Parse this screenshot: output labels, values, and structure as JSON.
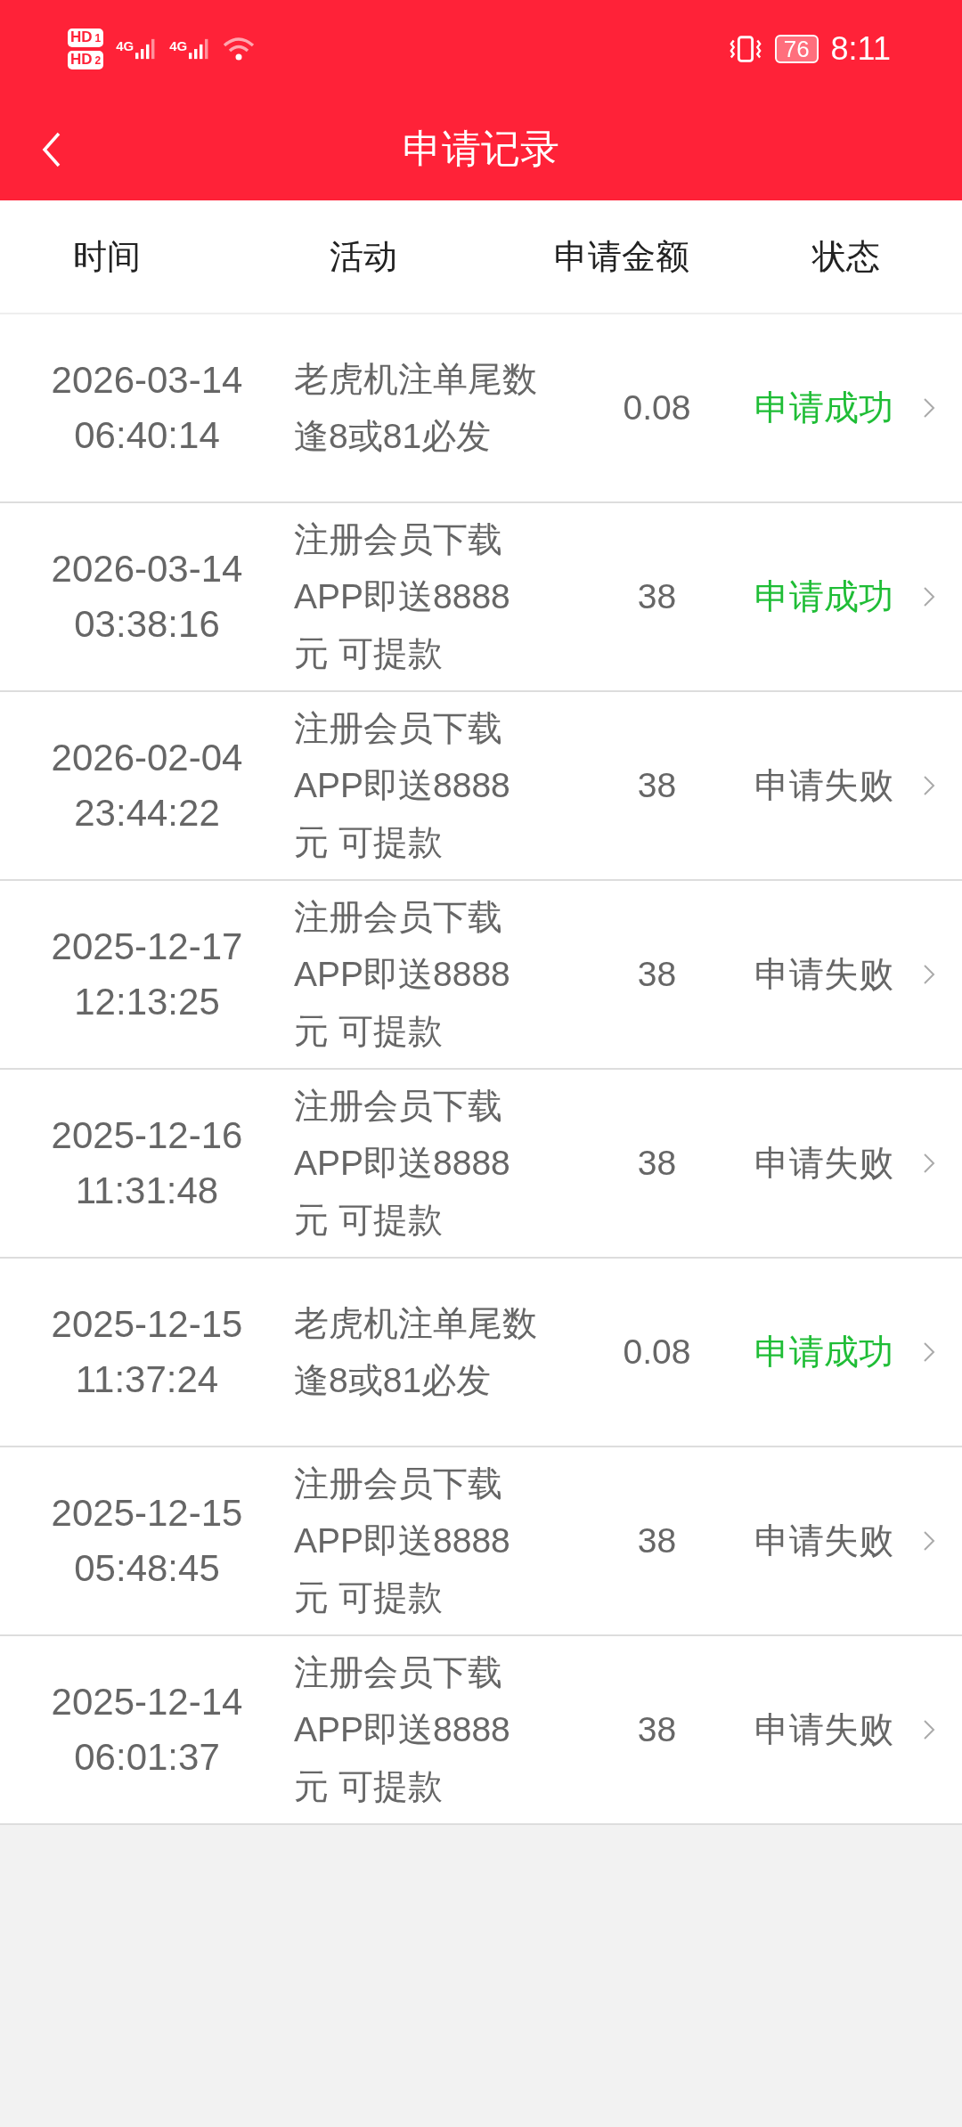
{
  "status_bar": {
    "sims": [
      {
        "label": "HD",
        "index": "1"
      },
      {
        "label": "HD",
        "index": "2"
      }
    ],
    "networks": [
      "4G",
      "4G"
    ],
    "battery": "76",
    "time": "8:11"
  },
  "header": {
    "title": "申请记录"
  },
  "columns": [
    "时间",
    "活动",
    "申请金额",
    "状态"
  ],
  "rows": [
    {
      "date": "2026-03-14",
      "time": "06:40:14",
      "activity": "老虎机注单尾数逢8或81必发",
      "amount": "0.08",
      "status": "申请成功",
      "success": true
    },
    {
      "date": "2026-03-14",
      "time": "03:38:16",
      "activity": "注册会员下载APP即送8888元 可提款",
      "amount": "38",
      "status": "申请成功",
      "success": true
    },
    {
      "date": "2026-02-04",
      "time": "23:44:22",
      "activity": "注册会员下载APP即送8888元 可提款",
      "amount": "38",
      "status": "申请失败",
      "success": false
    },
    {
      "date": "2025-12-17",
      "time": "12:13:25",
      "activity": "注册会员下载APP即送8888元 可提款",
      "amount": "38",
      "status": "申请失败",
      "success": false
    },
    {
      "date": "2025-12-16",
      "time": "11:31:48",
      "activity": "注册会员下载APP即送8888元 可提款",
      "amount": "38",
      "status": "申请失败",
      "success": false
    },
    {
      "date": "2025-12-15",
      "time": "11:37:24",
      "activity": "老虎机注单尾数逢8或81必发",
      "amount": "0.08",
      "status": "申请成功",
      "success": true
    },
    {
      "date": "2025-12-15",
      "time": "05:48:45",
      "activity": "注册会员下载APP即送8888元 可提款",
      "amount": "38",
      "status": "申请失败",
      "success": false
    },
    {
      "date": "2025-12-14",
      "time": "06:01:37",
      "activity": "注册会员下载APP即送8888元 可提款",
      "amount": "38",
      "status": "申请失败",
      "success": false
    }
  ]
}
